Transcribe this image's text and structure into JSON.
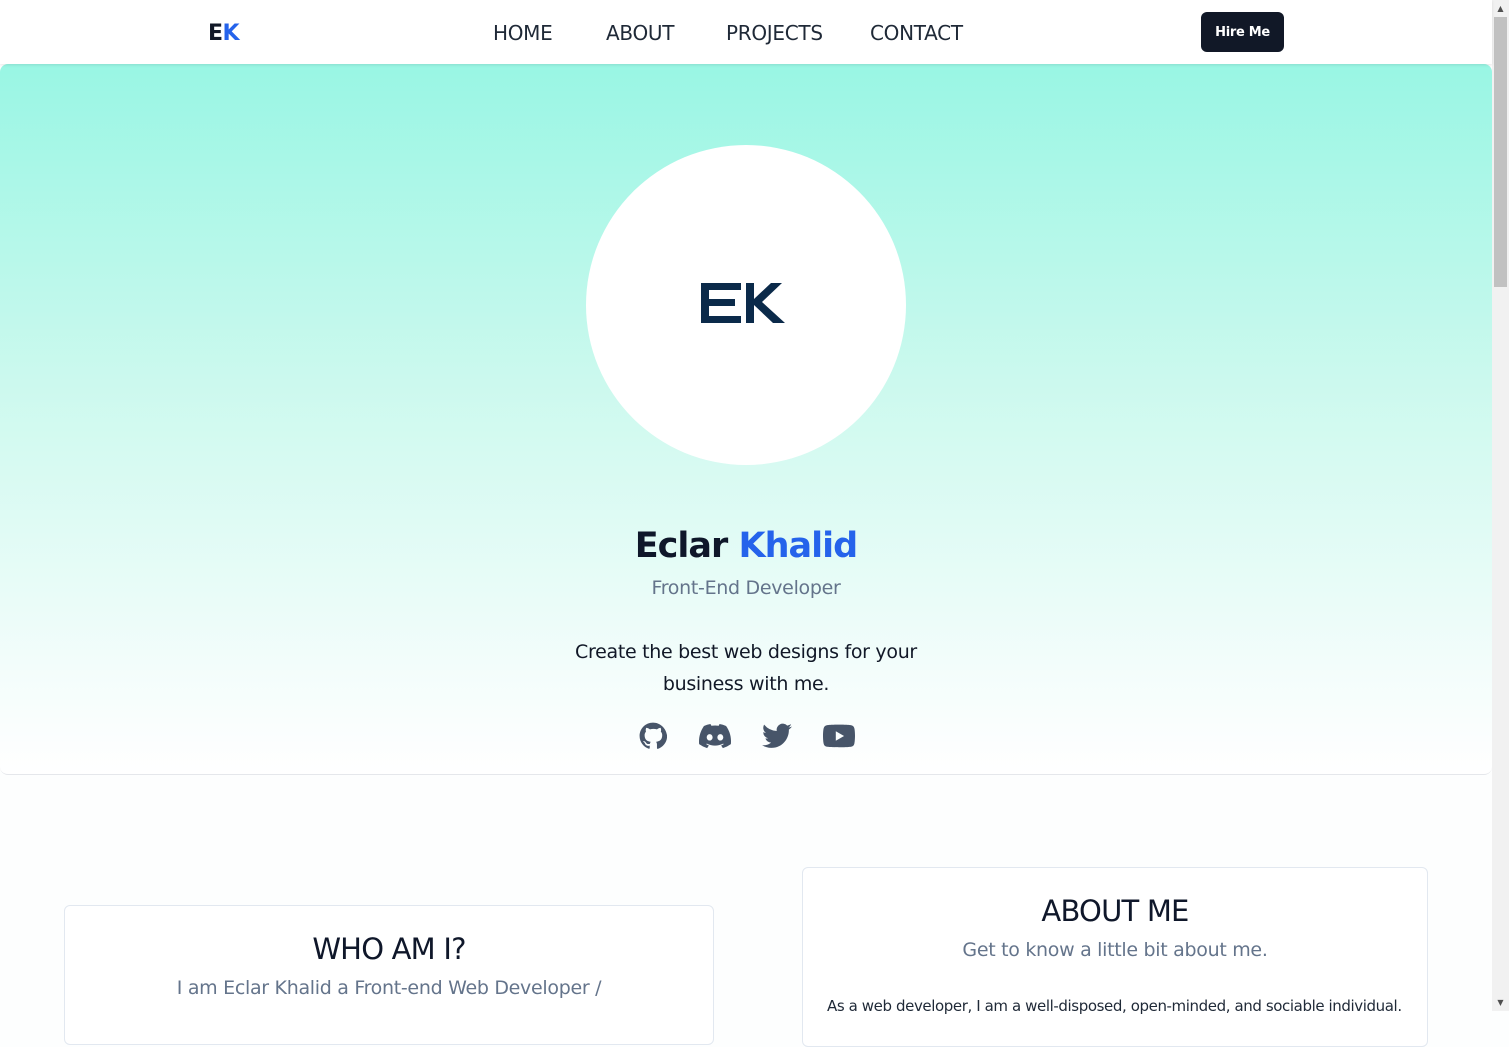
{
  "navbar": {
    "logo_part1": "E",
    "logo_part2": "K",
    "links": [
      "HOME",
      "ABOUT",
      "PROJECTS",
      "CONTACT"
    ],
    "hire_label": "Hire Me"
  },
  "hero": {
    "avatar_logo": "EK",
    "first_name": "Eclar",
    "last_name": "Khalid",
    "role": "Front-End Developer",
    "tagline": "Create the best web designs for your business with me.",
    "socials": [
      "github-icon",
      "discord-icon",
      "twitter-icon",
      "youtube-icon"
    ]
  },
  "who": {
    "title": "WHO AM I?",
    "subtitle": "I am Eclar Khalid a Front-end Web Developer /"
  },
  "about": {
    "title": "ABOUT ME",
    "subtitle": "Get to know a little bit about me.",
    "text": "As a web developer, I am a well-disposed, open-minded, and sociable individual."
  },
  "colors": {
    "accent": "#2563eb",
    "dark": "#111827",
    "hero_gradient_top": "#99f6e4",
    "muted": "#64748b"
  }
}
